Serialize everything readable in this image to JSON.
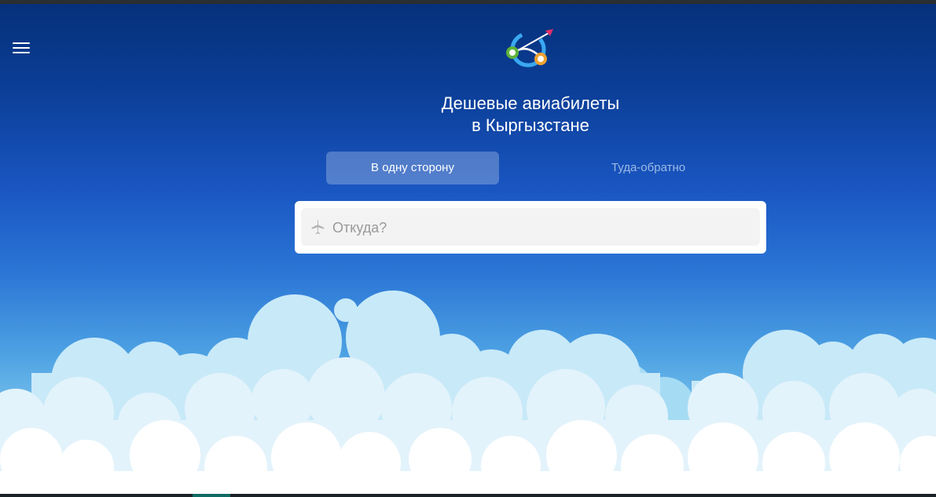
{
  "header": {
    "menu_icon": "hamburger-menu-icon",
    "logo_icon": "airplane-route-logo-icon"
  },
  "hero": {
    "title_line1": "Дешевые авиабилеты",
    "title_line2": "в Кыргызстане"
  },
  "trip_tabs": [
    {
      "label": "В одну сторону",
      "active": true
    },
    {
      "label": "Туда-обратно",
      "active": false
    }
  ],
  "search": {
    "from_placeholder": "Откуда?",
    "from_value": "",
    "from_icon": "airplane-icon"
  },
  "colors": {
    "sky_top": "#06307a",
    "sky_bottom": "#bfe5f7",
    "logo_blue": "#3aa8f0",
    "logo_green": "#5fb33a",
    "logo_orange": "#f0a030",
    "logo_pink": "#e0306a"
  }
}
